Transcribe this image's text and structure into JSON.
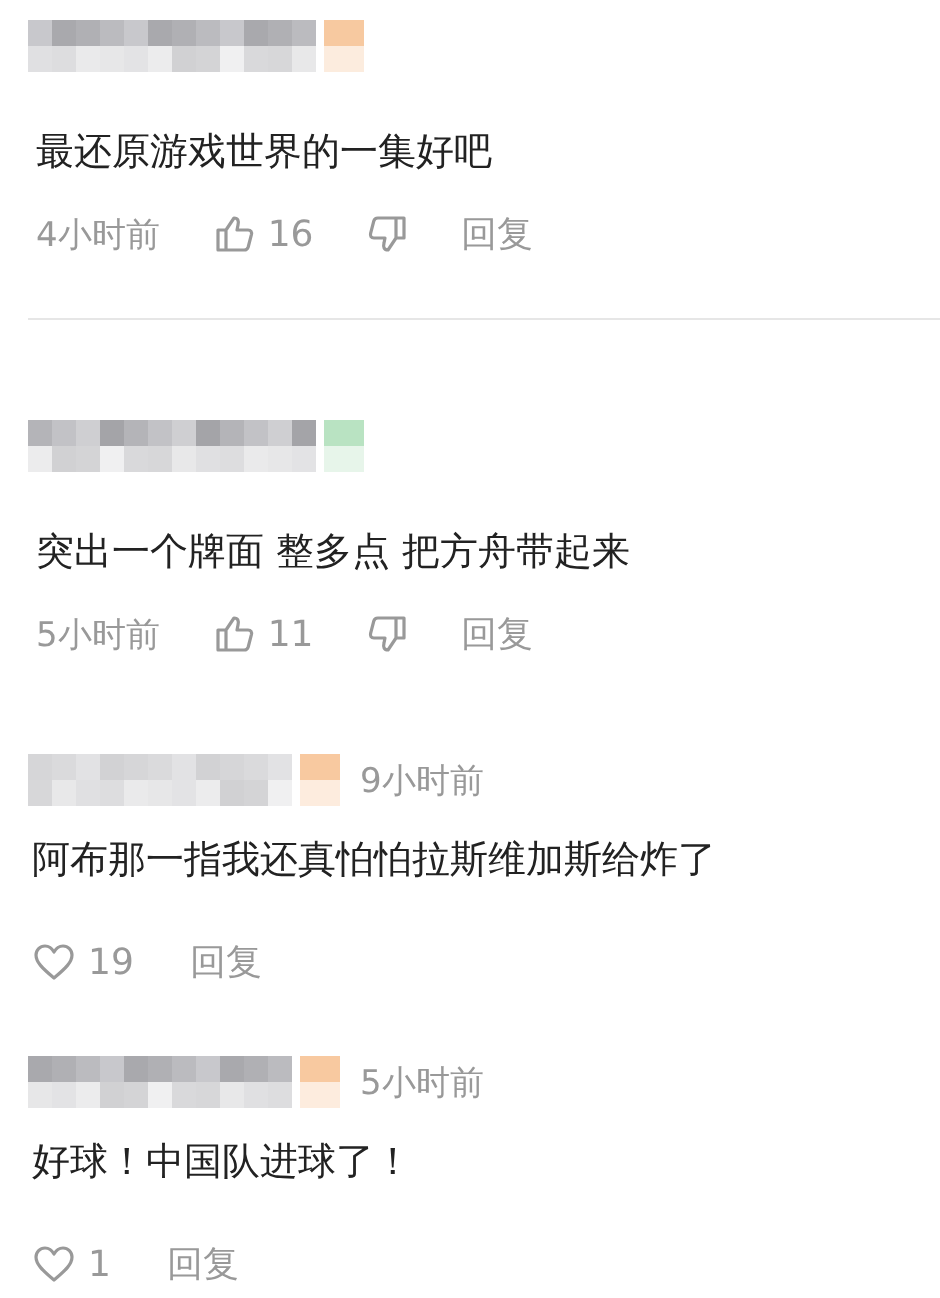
{
  "comments": [
    {
      "kind": "thumbs",
      "color": "#f7c9a0",
      "text": "最还原游戏世界的一集好吧",
      "time": "4小时前",
      "likes": "16",
      "reply": "回复",
      "divider_after": true
    },
    {
      "kind": "thumbs",
      "color": "#b9e3c2",
      "text": "突出一个牌面 整多点 把方舟带起来",
      "time": "5小时前",
      "likes": "11",
      "reply": "回复",
      "divider_after": false
    },
    {
      "kind": "heart",
      "color": "#f8c9a0",
      "text": "阿布那一指我还真怕怕拉斯维加斯给炸了",
      "time": "9小时前",
      "likes": "19",
      "reply": "回复",
      "divider_after": false
    },
    {
      "kind": "heart",
      "color": "#f8c9a0",
      "text": "好球！中国队进球了！",
      "time": "5小时前",
      "likes": "1",
      "reply": "回复",
      "divider_after": false
    }
  ]
}
